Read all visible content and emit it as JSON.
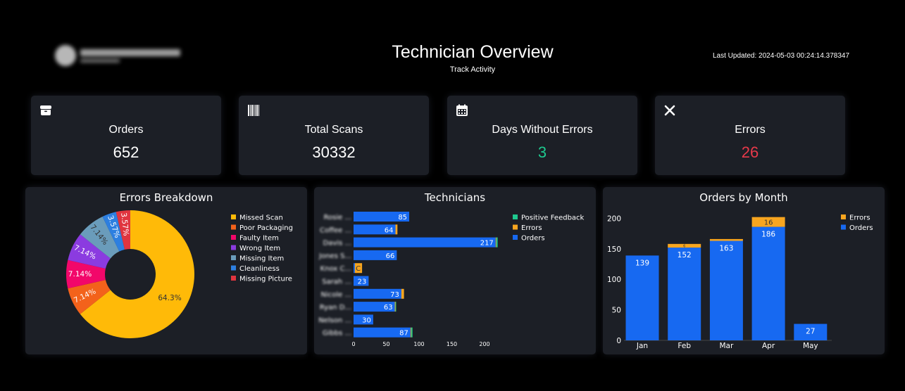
{
  "header": {
    "title": "Technician Overview",
    "subtitle": "Track Activity",
    "last_updated": "Last Updated: 2024-05-03 00:24:14.378347"
  },
  "kpis": [
    {
      "label": "Orders",
      "value": "652",
      "icon": "box-icon",
      "color": "#ffffff"
    },
    {
      "label": "Total Scans",
      "value": "30332",
      "icon": "barcode-icon",
      "color": "#ffffff"
    },
    {
      "label": "Days Without Errors",
      "value": "3",
      "icon": "calendar-icon",
      "color": "#1ec98f"
    },
    {
      "label": "Errors",
      "value": "26",
      "icon": "close-icon",
      "color": "#e8394a"
    }
  ],
  "colors": {
    "missed_scan": "#ffba08",
    "poor_packaging": "#f3621b",
    "faulty_item": "#f2076a",
    "wrong_item": "#8b3be0",
    "missing_item": "#6a9cbb",
    "cleanliness": "#2d7fe0",
    "missing_picture": "#e0353f",
    "positive_feedback": "#1ec98f",
    "errors": "#f7a51f",
    "orders": "#1769f1",
    "panel": "#1c1f26"
  },
  "chart_data": [
    {
      "type": "pie",
      "title": "Errors Breakdown",
      "hole": true,
      "legend_position": "top-right",
      "slices": [
        {
          "label": "Missed Scan",
          "value": 64.3,
          "text": "64.3%",
          "color": "#ffba08"
        },
        {
          "label": "Poor Packaging",
          "value": 7.14,
          "text": "7.14%",
          "color": "#f3621b"
        },
        {
          "label": "Faulty Item",
          "value": 7.14,
          "text": "7.14%",
          "color": "#f2076a"
        },
        {
          "label": "Wrong Item",
          "value": 7.14,
          "text": "7.14%",
          "color": "#8b3be0"
        },
        {
          "label": "Missing Item",
          "value": 7.14,
          "text": "7.14%",
          "color": "#6a9cbb"
        },
        {
          "label": "Cleanliness",
          "value": 3.57,
          "text": "3.57%",
          "color": "#2d7fe0"
        },
        {
          "label": "Missing Picture",
          "value": 3.57,
          "text": "3.57%",
          "color": "#e0353f"
        }
      ]
    },
    {
      "type": "bar",
      "orientation": "horizontal",
      "stacked": true,
      "title": "Technicians",
      "legend_position": "top-right",
      "xlim": [
        0,
        230
      ],
      "xticks": [
        0,
        50,
        100,
        150,
        200
      ],
      "categories": [
        "Rosie ...",
        "Coffee ...",
        "Davis ...",
        "Jones S...",
        "Knox C...",
        "Sarah ...",
        "Nicole ...",
        "Ryan D...",
        "Nelson ...",
        "Gibbs ..."
      ],
      "series": [
        {
          "name": "Orders",
          "color": "#1769f1",
          "values": [
            85,
            64,
            217,
            66,
            2,
            23,
            73,
            63,
            30,
            87
          ]
        },
        {
          "name": "Errors",
          "color": "#f7a51f",
          "values": [
            0,
            3,
            1,
            0,
            11,
            0,
            4,
            1,
            0,
            1
          ]
        },
        {
          "name": "Positive Feedback",
          "color": "#1ec98f",
          "values": [
            0,
            0,
            2,
            0,
            0,
            0,
            0,
            1,
            0,
            2
          ]
        }
      ],
      "labels": [
        "85",
        "64",
        "217",
        "66",
        "C",
        "23",
        "73",
        "63",
        "30",
        "87"
      ]
    },
    {
      "type": "bar",
      "stacked": true,
      "title": "Orders by Month",
      "legend_position": "top-right",
      "ylim": [
        0,
        210
      ],
      "yticks": [
        0,
        50,
        100,
        150,
        200
      ],
      "categories": [
        "Jan",
        "Feb",
        "Mar",
        "Apr",
        "May"
      ],
      "series": [
        {
          "name": "Orders",
          "color": "#1769f1",
          "values": [
            139,
            152,
            163,
            186,
            27
          ],
          "labels": [
            "139",
            "152",
            "163",
            "186",
            "27"
          ]
        },
        {
          "name": "Errors",
          "color": "#f7a51f",
          "values": [
            0,
            6,
            3,
            16,
            0
          ],
          "labels": [
            "",
            "6",
            "",
            "16",
            ""
          ]
        }
      ]
    }
  ]
}
